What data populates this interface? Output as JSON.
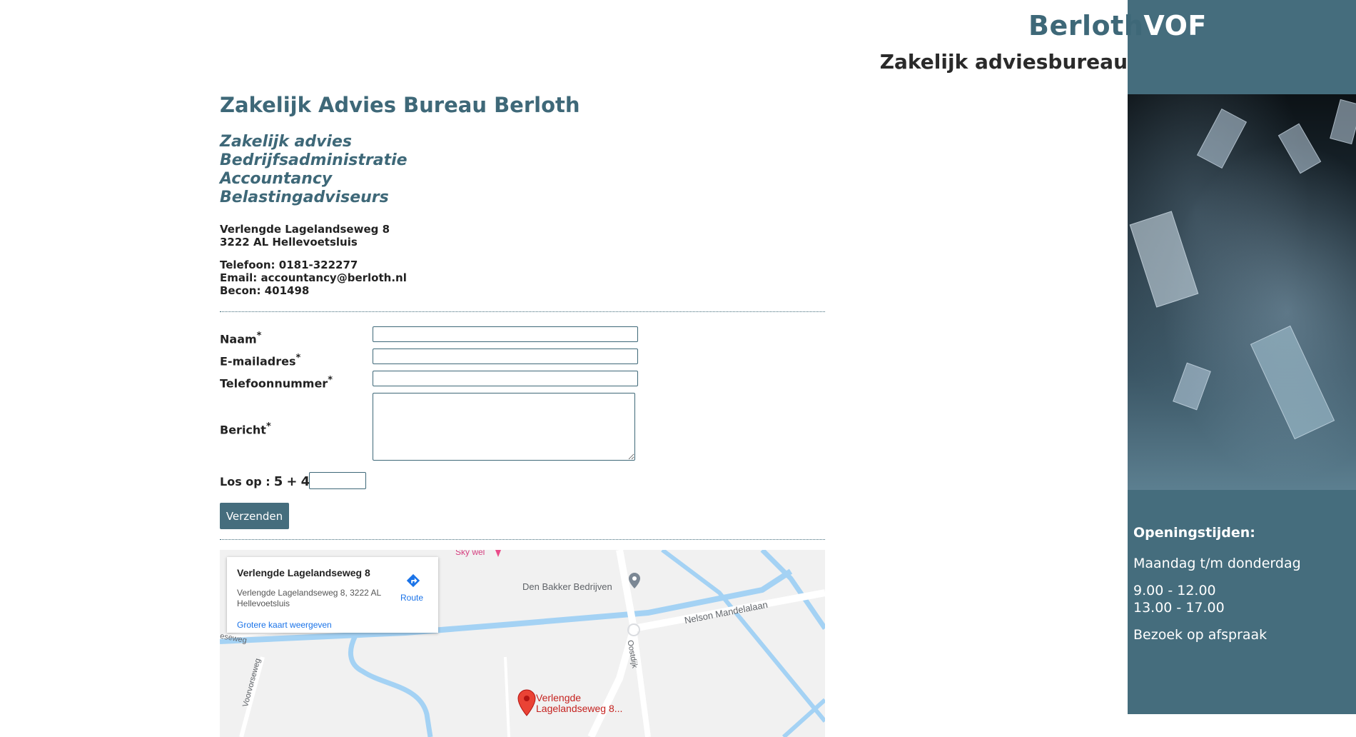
{
  "header": {
    "brand_main": "Berloth",
    "brand_suffix": "VOF",
    "subtitle": "Zakelijk adviesbureau"
  },
  "main": {
    "title": "Zakelijk Advies Bureau Berloth",
    "services": [
      "Zakelijk advies",
      "Bedrijfsadministratie",
      "Accountancy",
      "Belastingadviseurs"
    ],
    "address": [
      "Verlengde Lagelandseweg 8",
      "3222 AL Hellevoetsluis"
    ],
    "contact": [
      "Telefoon: 0181-322277",
      "Email: accountancy@berloth.nl",
      "Becon: 401498"
    ]
  },
  "form": {
    "fields": [
      {
        "label": "Naam",
        "required": "*",
        "value": ""
      },
      {
        "label": "E-mailadres",
        "required": "*",
        "value": ""
      },
      {
        "label": "Telefoonnummer",
        "required": "*",
        "value": ""
      }
    ],
    "message": {
      "label": "Bericht",
      "required": "*",
      "value": ""
    },
    "captcha": {
      "label": "Los op :",
      "a": "5",
      "op": "+",
      "b": "4",
      "value": ""
    },
    "submit_label": "Verzenden"
  },
  "map": {
    "card_title": "Verlengde Lagelandseweg 8",
    "card_address": "Verlengde Lagelandseweg 8, 3222 AL Hellevoetsluis",
    "route_label": "Route",
    "bigger_map_label": "Grotere kaart weergeven",
    "labels": {
      "den_bakker": "Den Bakker Bedrijven",
      "nelson": "Nelson Mandelalaan",
      "voorvoorseweg": "Voorvorseweg",
      "oostdijk": "Oostdijk",
      "sky": "Sky wel",
      "lageland": "eseweg",
      "pin": "Verlengde Lagelandseweg 8..."
    }
  },
  "sidebar": {
    "heading": "Openingstijden:",
    "days": "Maandag t/m donderdag",
    "hours": [
      "9.00 - 12.00",
      "13.00 - 17.00"
    ],
    "note": "Bezoek op afspraak"
  }
}
